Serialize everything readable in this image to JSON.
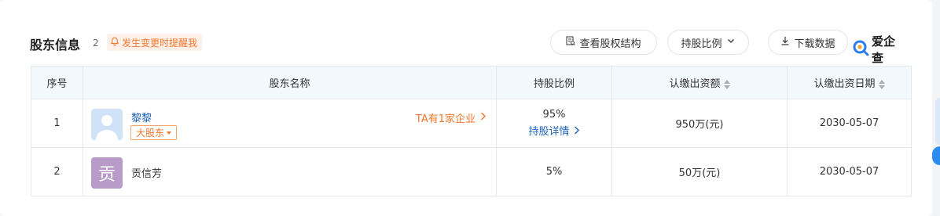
{
  "section": {
    "title": "股东信息",
    "count": "2",
    "remind_label": "发生变更时提醒我"
  },
  "toolbar": {
    "structure_label": "查看股权结构",
    "ratio_label": "持股比例",
    "download_label": "下载数据",
    "logo_text": "爱企查"
  },
  "table": {
    "headers": {
      "index": "序号",
      "name": "股东名称",
      "ratio": "持股比例",
      "capital": "认缴出资额",
      "date": "认缴出资日期"
    },
    "rows": [
      {
        "index": "1",
        "avatar_letter": "",
        "name": "黎黎",
        "tag": "大股东",
        "related": "TA有1家企业",
        "ratio": "95%",
        "detail": "持股详情",
        "capital": "950万(元)",
        "date": "2030-05-07"
      },
      {
        "index": "2",
        "avatar_letter": "贡",
        "name": "贡信芳",
        "ratio": "5%",
        "capital": "50万(元)",
        "date": "2030-05-07"
      }
    ]
  },
  "colors": {
    "accent_orange": "#f2762b",
    "link_blue": "#1a62ba",
    "header_bg": "#f3f8fd"
  }
}
